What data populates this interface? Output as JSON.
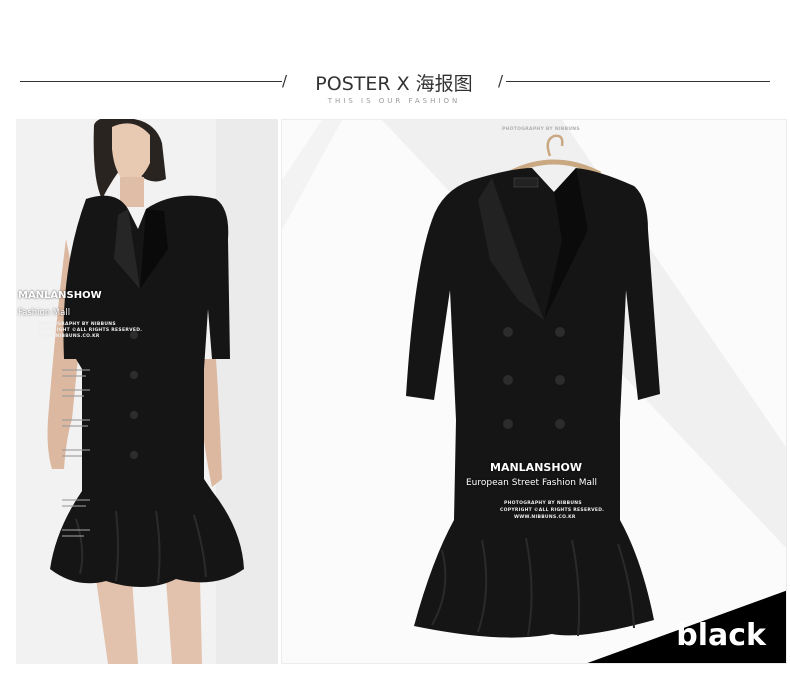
{
  "header": {
    "title": "POSTER X 海报图",
    "subtitle": "THIS IS OUR FASHION",
    "slash": "/"
  },
  "watermark": {
    "brand": "MANLANSHOW",
    "tagline": "European Street Fashion Mall",
    "tagline_cut": "Fashion Mall",
    "credit": "PHOTOGRAPHY BY NIBBUNS",
    "copyright": "COPYRIGHT ©ALL RIGHTS RESERVED.",
    "site": "WWW.NIBBUNS.CO.KR"
  },
  "color_badge": {
    "label": "black"
  },
  "colors": {
    "line": "#333333",
    "dress": "#151515",
    "badge": "#000000"
  }
}
